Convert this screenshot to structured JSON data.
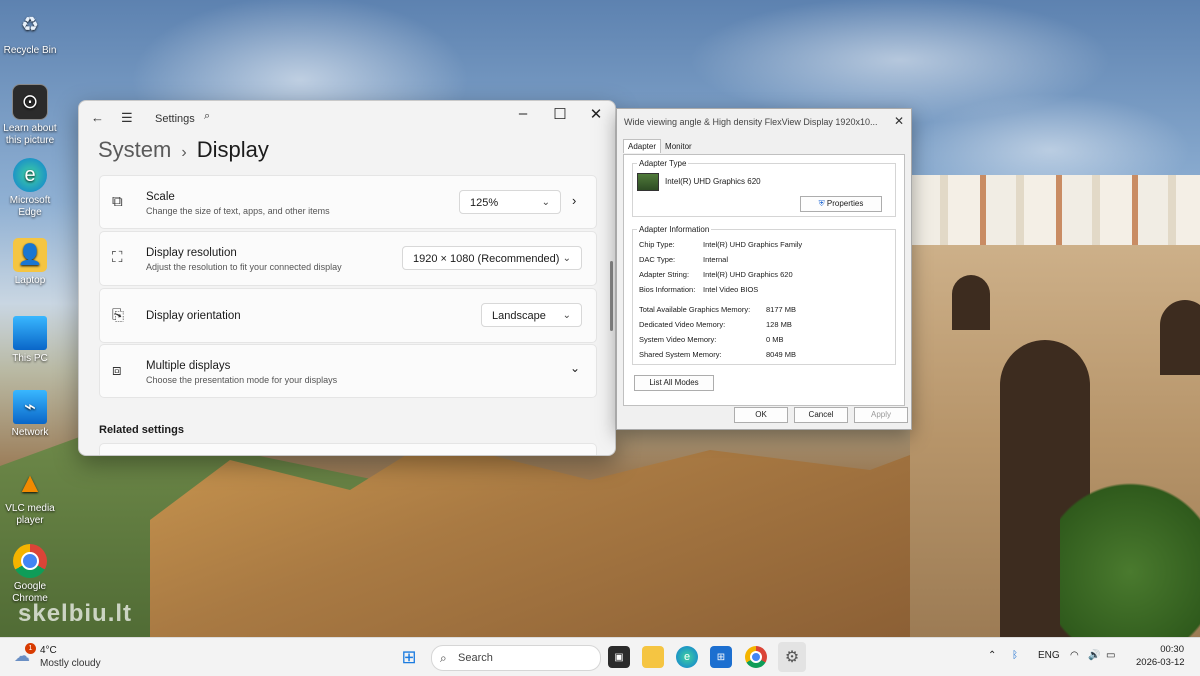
{
  "desktop": {
    "icons": [
      {
        "label": "Recycle Bin",
        "icon": "recycle-bin-icon"
      },
      {
        "label": "Learn about this picture",
        "icon": "learn-picture-icon"
      },
      {
        "label": "Microsoft Edge",
        "icon": "edge-icon"
      },
      {
        "label": "Laptop",
        "icon": "user-folder-icon"
      },
      {
        "label": "This PC",
        "icon": "monitor-icon"
      },
      {
        "label": "Network",
        "icon": "network-icon"
      },
      {
        "label": "VLC media player",
        "icon": "vlc-icon"
      },
      {
        "label": "Google Chrome",
        "icon": "chrome-icon"
      }
    ],
    "watermark": "skelbiu.lt"
  },
  "settings": {
    "app_title": "Settings",
    "breadcrumb": {
      "parent": "System",
      "current": "Display"
    },
    "cards": {
      "scale": {
        "title": "Scale",
        "subtitle": "Change the size of text, apps, and other items",
        "value": "125%"
      },
      "resolution": {
        "title": "Display resolution",
        "subtitle": "Adjust the resolution to fit your connected display",
        "value": "1920 × 1080 (Recommended)"
      },
      "orientation": {
        "title": "Display orientation",
        "value": "Landscape"
      },
      "multiple": {
        "title": "Multiple displays",
        "subtitle": "Choose the presentation mode for your displays"
      }
    },
    "related_settings": "Related settings"
  },
  "adapter_dialog": {
    "title": "Wide viewing angle & High density FlexView Display 1920x10...",
    "tabs": [
      "Adapter",
      "Monitor"
    ],
    "adapter_type": {
      "label": "Adapter Type",
      "name": "Intel(R) UHD Graphics 620",
      "properties_button": "Properties"
    },
    "adapter_information": {
      "label": "Adapter Information",
      "chip_type": {
        "k": "Chip Type:",
        "v": "Intel(R) UHD Graphics Family"
      },
      "dac_type": {
        "k": "DAC Type:",
        "v": "Internal"
      },
      "adapter_string": {
        "k": "Adapter String:",
        "v": "Intel(R) UHD Graphics 620"
      },
      "bios_info": {
        "k": "Bios Information:",
        "v": "Intel Video BIOS"
      },
      "total_memory": {
        "k": "Total Available Graphics Memory:",
        "v": "8177 MB"
      },
      "dedicated_memory": {
        "k": "Dedicated Video Memory:",
        "v": "128 MB"
      },
      "system_memory": {
        "k": "System Video Memory:",
        "v": "0 MB"
      },
      "shared_memory": {
        "k": "Shared System Memory:",
        "v": "8049 MB"
      }
    },
    "list_all_modes": "List All Modes",
    "buttons": {
      "ok": "OK",
      "cancel": "Cancel",
      "apply": "Apply"
    }
  },
  "taskbar": {
    "weather": {
      "badge": "1",
      "temp": "4°C",
      "condition": "Mostly cloudy"
    },
    "search_placeholder": "Search",
    "tray": {
      "language": "ENG",
      "time": "00:30",
      "date": "2026-03-12"
    }
  }
}
